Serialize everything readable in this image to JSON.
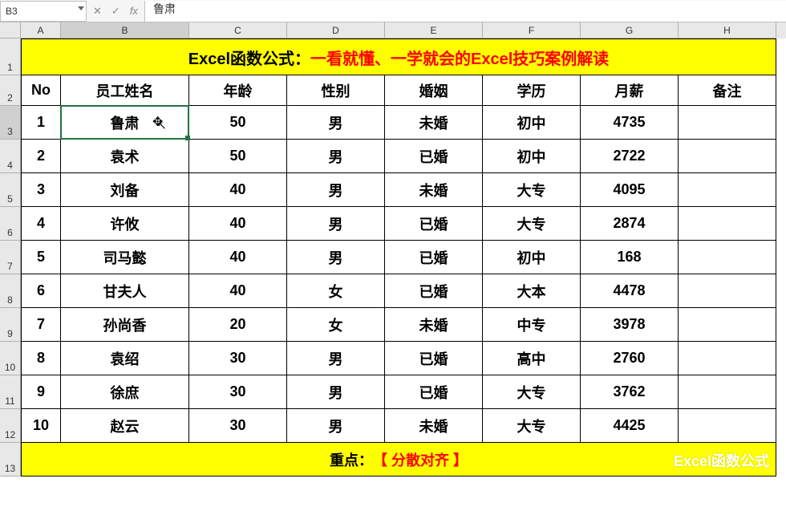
{
  "name_box": "B3",
  "formula_value": "鲁肃",
  "columns": [
    "A",
    "B",
    "C",
    "D",
    "E",
    "F",
    "G",
    "H"
  ],
  "title": {
    "prefix": "Excel函数公式：",
    "main": "一看就懂、一学就会的Excel技巧案例解读"
  },
  "headers": {
    "no": "No",
    "name": "员工姓名",
    "age": "年龄",
    "gender": "性别",
    "marriage": "婚姻",
    "education": "学历",
    "salary": "月薪",
    "remark": "备注"
  },
  "rows": [
    {
      "no": "1",
      "name": "鲁肃",
      "age": "50",
      "gender": "男",
      "marriage": "未婚",
      "education": "初中",
      "salary": "4735",
      "remark": ""
    },
    {
      "no": "2",
      "name": "袁术",
      "age": "50",
      "gender": "男",
      "marriage": "已婚",
      "education": "初中",
      "salary": "2722",
      "remark": ""
    },
    {
      "no": "3",
      "name": "刘备",
      "age": "40",
      "gender": "男",
      "marriage": "未婚",
      "education": "大专",
      "salary": "4095",
      "remark": ""
    },
    {
      "no": "4",
      "name": "许攸",
      "age": "40",
      "gender": "男",
      "marriage": "已婚",
      "education": "大专",
      "salary": "2874",
      "remark": ""
    },
    {
      "no": "5",
      "name": "司马懿",
      "age": "40",
      "gender": "男",
      "marriage": "已婚",
      "education": "初中",
      "salary": "168",
      "remark": ""
    },
    {
      "no": "6",
      "name": "甘夫人",
      "age": "40",
      "gender": "女",
      "marriage": "已婚",
      "education": "大本",
      "salary": "4478",
      "remark": ""
    },
    {
      "no": "7",
      "name": "孙尚香",
      "age": "20",
      "gender": "女",
      "marriage": "未婚",
      "education": "中专",
      "salary": "3978",
      "remark": ""
    },
    {
      "no": "8",
      "name": "袁绍",
      "age": "30",
      "gender": "男",
      "marriage": "已婚",
      "education": "高中",
      "salary": "2760",
      "remark": ""
    },
    {
      "no": "9",
      "name": "徐庶",
      "age": "30",
      "gender": "男",
      "marriage": "已婚",
      "education": "大专",
      "salary": "3762",
      "remark": ""
    },
    {
      "no": "10",
      "name": "赵云",
      "age": "30",
      "gender": "男",
      "marriage": "未婚",
      "education": "大专",
      "salary": "4425",
      "remark": ""
    }
  ],
  "footer": {
    "prefix": "重点：",
    "main": "【 分散对齐 】"
  },
  "watermark": "Excel函数公式",
  "row_indices": [
    "1",
    "2",
    "3",
    "4",
    "5",
    "6",
    "7",
    "8",
    "9",
    "10",
    "11",
    "12",
    "13"
  ]
}
